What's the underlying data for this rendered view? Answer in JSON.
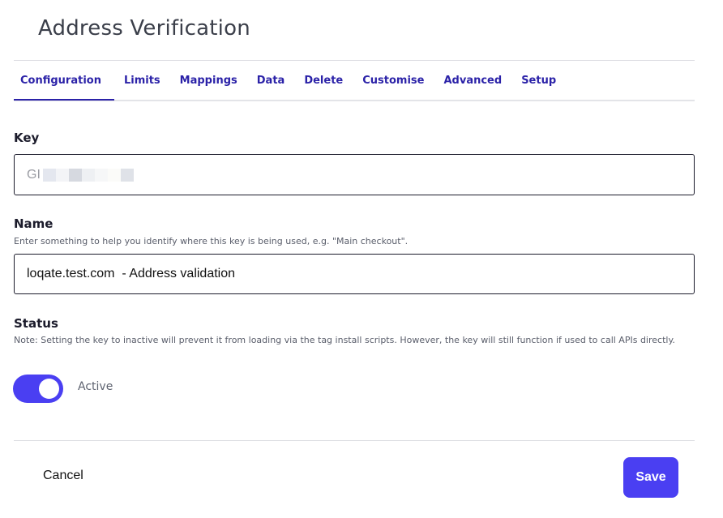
{
  "page": {
    "title": "Address Verification"
  },
  "tabs": [
    {
      "label": "Configuration",
      "active": true
    },
    {
      "label": "Limits"
    },
    {
      "label": "Mappings"
    },
    {
      "label": "Data"
    },
    {
      "label": "Delete"
    },
    {
      "label": "Customise"
    },
    {
      "label": "Advanced"
    },
    {
      "label": "Setup"
    }
  ],
  "key": {
    "label": "Key",
    "value_visible_prefix": "GI",
    "masked": true,
    "mask_colors": [
      "#e4e7ef",
      "#f3f4f7",
      "#d6d9e0",
      "#eef0f3",
      "#f6f7f8",
      "#fbfbf9",
      "#dfe2e8"
    ]
  },
  "name": {
    "label": "Name",
    "help": "Enter something to help you identify where this key is being used, e.g. \"Main checkout\".",
    "value": "loqate.test.com  - Address validation"
  },
  "status": {
    "label": "Status",
    "help": "Note: Setting the key to inactive will prevent it from loading via the tag install scripts. However, the key will still function if used to call APIs directly.",
    "toggle_on": true,
    "toggle_label": "Active"
  },
  "footer": {
    "cancel_label": "Cancel",
    "save_label": "Save"
  },
  "colors": {
    "accent": "#4a3ff2",
    "tab_text": "#2b22a8"
  }
}
